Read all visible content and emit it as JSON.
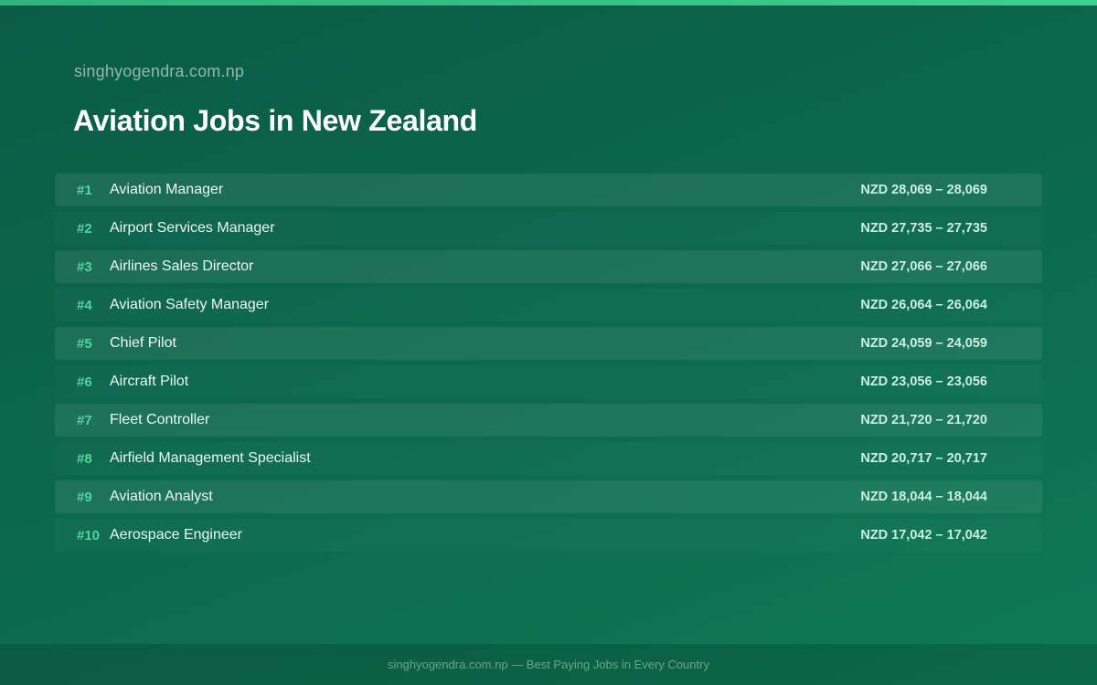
{
  "site": "singhyogendra.com.np",
  "title": "Aviation Jobs in New Zealand",
  "jobs": [
    {
      "rank": "#1",
      "title": "Aviation Manager",
      "salary": "NZD 28,069 – 28,069"
    },
    {
      "rank": "#2",
      "title": "Airport Services Manager",
      "salary": "NZD 27,735 – 27,735"
    },
    {
      "rank": "#3",
      "title": "Airlines Sales Director",
      "salary": "NZD 27,066 – 27,066"
    },
    {
      "rank": "#4",
      "title": "Aviation Safety Manager",
      "salary": "NZD 26,064 – 26,064"
    },
    {
      "rank": "#5",
      "title": "Chief Pilot",
      "salary": "NZD 24,059 – 24,059"
    },
    {
      "rank": "#6",
      "title": "Aircraft Pilot",
      "salary": "NZD 23,056 – 23,056"
    },
    {
      "rank": "#7",
      "title": "Fleet Controller",
      "salary": "NZD 21,720 – 21,720"
    },
    {
      "rank": "#8",
      "title": "Airfield Management Specialist",
      "salary": "NZD 20,717 – 20,717"
    },
    {
      "rank": "#9",
      "title": "Aviation Analyst",
      "salary": "NZD 18,044 – 18,044"
    },
    {
      "rank": "#10",
      "title": "Aerospace Engineer",
      "salary": "NZD 17,042 – 17,042"
    }
  ],
  "footer": "singhyogendra.com.np — Best Paying Jobs in Every Country",
  "colors": {
    "background": "#0c6a4e",
    "accent": "#3dd08f",
    "rank": "#4fd79b"
  }
}
